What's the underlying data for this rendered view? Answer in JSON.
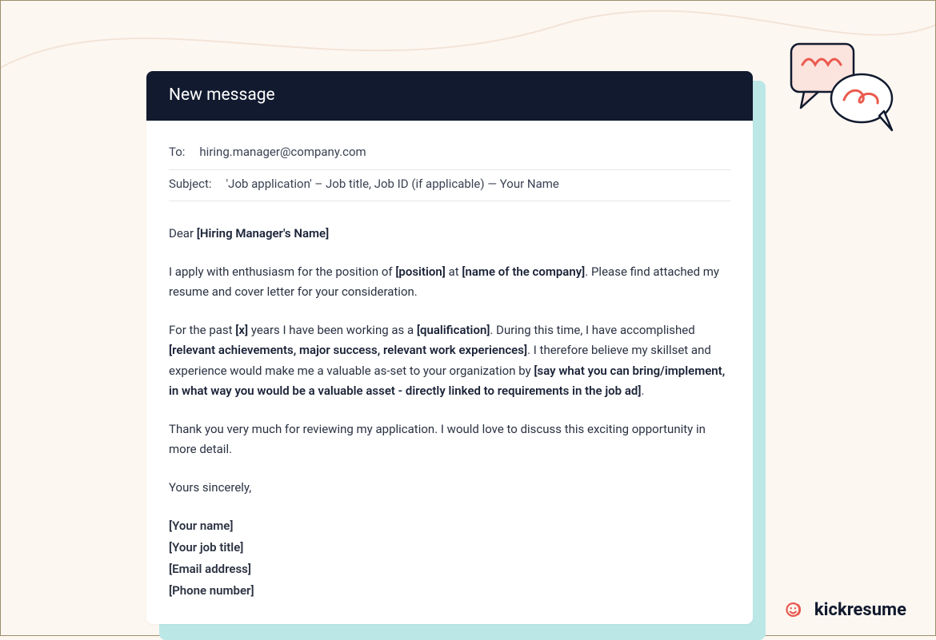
{
  "header": {
    "title": "New message"
  },
  "meta": {
    "to_label": "To:",
    "to_value": "hiring.manager@company.com",
    "subject_label": "Subject:",
    "subject_value": "'Job application' – Job title, Job ID (if applicable) — Your Name"
  },
  "body": {
    "greeting_pre": "Dear ",
    "greeting_placeholder": "[Hiring Manager's Name]",
    "p1_a": "I apply with enthusiasm for the position of ",
    "p1_b": "[position]",
    "p1_c": " at ",
    "p1_d": "[name of the company]",
    "p1_e": ". Please find attached my resume and cover letter for your consideration.",
    "p2_a": "For the past ",
    "p2_b": "[x]",
    "p2_c": " years I have been working as a ",
    "p2_d": "[qualification]",
    "p2_e": ". During this time, I have accomplished ",
    "p2_f": "[relevant achievements, major success, relevant work experiences]",
    "p2_g": ". I therefore believe my skillset and experience would make me a valuable as-set to your organization by ",
    "p2_h": "[say what you can bring/implement, in what way you would be a valuable asset - directly linked to requirements in the job ad]",
    "p2_i": ".",
    "p3": "Thank you very much for reviewing my application. I would love to discuss this exciting opportunity in more detail.",
    "closing": "Yours sincerely,",
    "sig_name": "[Your name]",
    "sig_title": "[Your job title]",
    "sig_email": "[Email address]",
    "sig_phone": "[Phone number]"
  },
  "brand": {
    "name": "kickresume"
  }
}
